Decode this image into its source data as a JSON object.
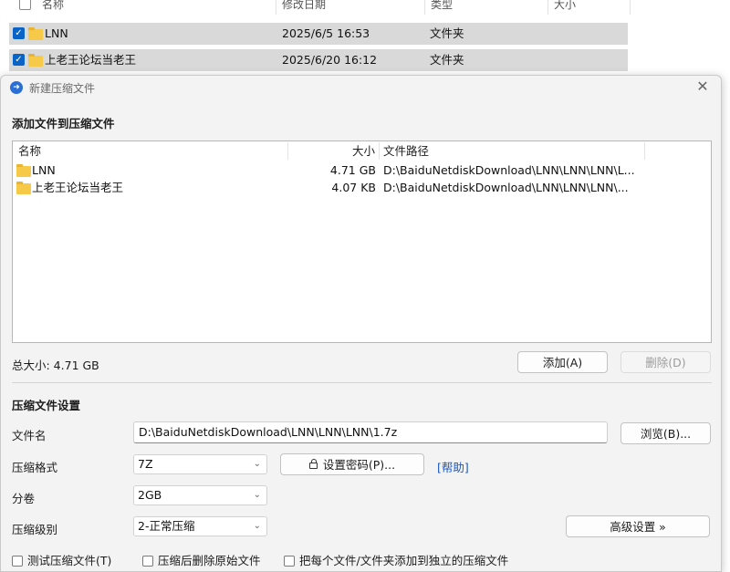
{
  "explorer": {
    "columns": [
      "名称",
      "修改日期",
      "类型",
      "大小"
    ],
    "rows": [
      {
        "name": "LNN",
        "date": "2025/6/5 16:53",
        "type": "文件夹"
      },
      {
        "name": "上老王论坛当老王",
        "date": "2025/6/20 16:12",
        "type": "文件夹"
      }
    ]
  },
  "dialog": {
    "title": "新建压缩文件",
    "add_section_title": "添加文件到压缩文件",
    "file_list": {
      "columns": {
        "name": "名称",
        "size": "大小",
        "path": "文件路径"
      },
      "rows": [
        {
          "name": "LNN",
          "size": "4.71 GB",
          "path": "D:\\BaiduNetdiskDownload\\LNN\\LNN\\LNN\\L..."
        },
        {
          "name": "上老王论坛当老王",
          "size": "4.07 KB",
          "path": "D:\\BaiduNetdiskDownload\\LNN\\LNN\\LNN\\..."
        }
      ]
    },
    "total_size": "总大小: 4.71 GB",
    "add_button": "添加(A)",
    "delete_button": "删除(D)",
    "settings_title": "压缩文件设置",
    "filename_label": "文件名",
    "filename_value": "D:\\BaiduNetdiskDownload\\LNN\\LNN\\LNN\\1.7z",
    "browse_button": "浏览(B)...",
    "format_label": "压缩格式",
    "format_value": "7Z",
    "password_button": "设置密码(P)...",
    "help_link": "[帮助]",
    "split_label": "分卷",
    "split_value": "2GB",
    "level_label": "压缩级别",
    "level_value": "2-正常压缩",
    "advanced_button": "高级设置 »",
    "options": [
      "测试压缩文件(T)",
      "压缩后删除原始文件",
      "把每个文件/文件夹添加到独立的压缩文件"
    ]
  },
  "colors": {
    "accent": "#0a64c8",
    "link": "#1a56c2",
    "folder": "#f7c948",
    "dialog_bg": "#f3f3f3"
  }
}
